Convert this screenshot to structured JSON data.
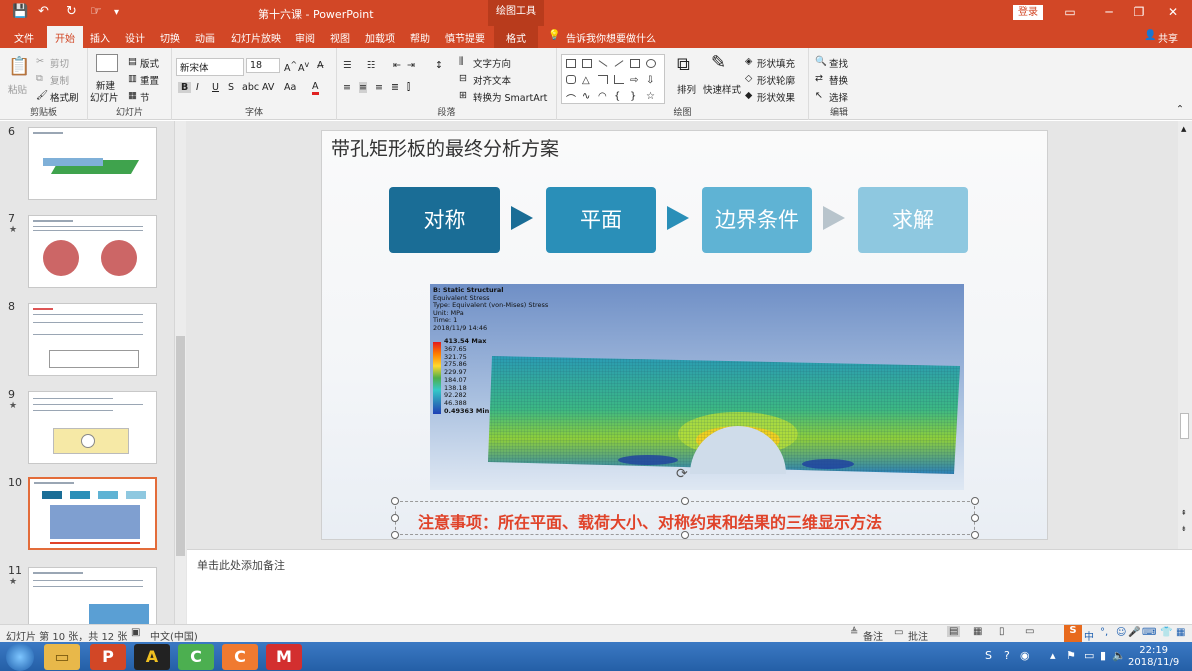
{
  "titlebar": {
    "doc_title": "第十六课 - PowerPoint",
    "context_tab": "绘图工具",
    "login": "登录",
    "quick_access": {
      "save": "💾",
      "undo": "↶",
      "redo": "↻",
      "customize": "▾"
    }
  },
  "tabs": [
    "文件",
    "开始",
    "插入",
    "设计",
    "切换",
    "动画",
    "幻灯片放映",
    "审阅",
    "视图",
    "加载项",
    "帮助",
    "慎节提要",
    "格式"
  ],
  "tell_me": "告诉我你想要做什么",
  "share": "共享",
  "ribbon": {
    "clipboard": {
      "paste": "粘贴",
      "cut": "剪切",
      "copy": "复制",
      "format_painter": "格式刷",
      "label": "剪贴板"
    },
    "slides": {
      "new_slide": "新建",
      "new_slide2": "幻灯片",
      "layout": "版式",
      "reset": "重置",
      "section": "节",
      "label": "幻灯片"
    },
    "font": {
      "font_name": "新宋体",
      "font_size": "18",
      "label": "字体"
    },
    "paragraph": {
      "text_direction": "文字方向",
      "align_text": "对齐文本",
      "smartart": "转换为 SmartArt",
      "label": "段落"
    },
    "drawing": {
      "arrange": "排列",
      "quick_styles": "快速样式",
      "shape_fill": "形状填充",
      "shape_outline": "形状轮廓",
      "shape_effects": "形状效果",
      "label": "绘图"
    },
    "editing": {
      "find": "查找",
      "replace": "替换",
      "select": "选择",
      "label": "编辑"
    }
  },
  "thumbnails": [
    {
      "num": "6",
      "star": ""
    },
    {
      "num": "7",
      "star": "★"
    },
    {
      "num": "8",
      "star": ""
    },
    {
      "num": "9",
      "star": "★"
    },
    {
      "num": "10",
      "star": ""
    },
    {
      "num": "11",
      "star": "★"
    }
  ],
  "slide": {
    "title": "带孔矩形板的最终分析方案",
    "steps": [
      "对称",
      "平面",
      "边界条件",
      "求解"
    ],
    "sim": {
      "lines": [
        "B: Static Structural",
        "Equivalent Stress",
        "Type: Equivalent (von-Mises) Stress",
        "Unit: MPa",
        "Time: 1",
        "2018/11/9 14:46"
      ],
      "legend": [
        "413.54 Max",
        "367.65",
        "321.75",
        "275.86",
        "229.97",
        "184.07",
        "138.18",
        "92.282",
        "46.388",
        "0.49363 Min"
      ]
    },
    "note": "注意事项：所在平面、载荷大小、对称约束和结果的三维显示方法"
  },
  "notes_placeholder": "单击此处添加备注",
  "status": {
    "slide_info": "幻灯片 第 10 张，共 12 张",
    "language": "中文(中国)",
    "notes": "备注",
    "comments": "批注",
    "ime": "中"
  },
  "clock": {
    "time": "22:19",
    "date": "2018/11/9"
  },
  "taskbar_apps": [
    "P",
    "A",
    "C",
    "C",
    "M"
  ],
  "colors": {
    "accent": "#d24726",
    "step_dark": "#1a6d96",
    "step_mid": "#2a8fb8",
    "step_light": "#5fb3d4",
    "step_pale": "#8ec8e0",
    "note_red": "#e0432a"
  }
}
